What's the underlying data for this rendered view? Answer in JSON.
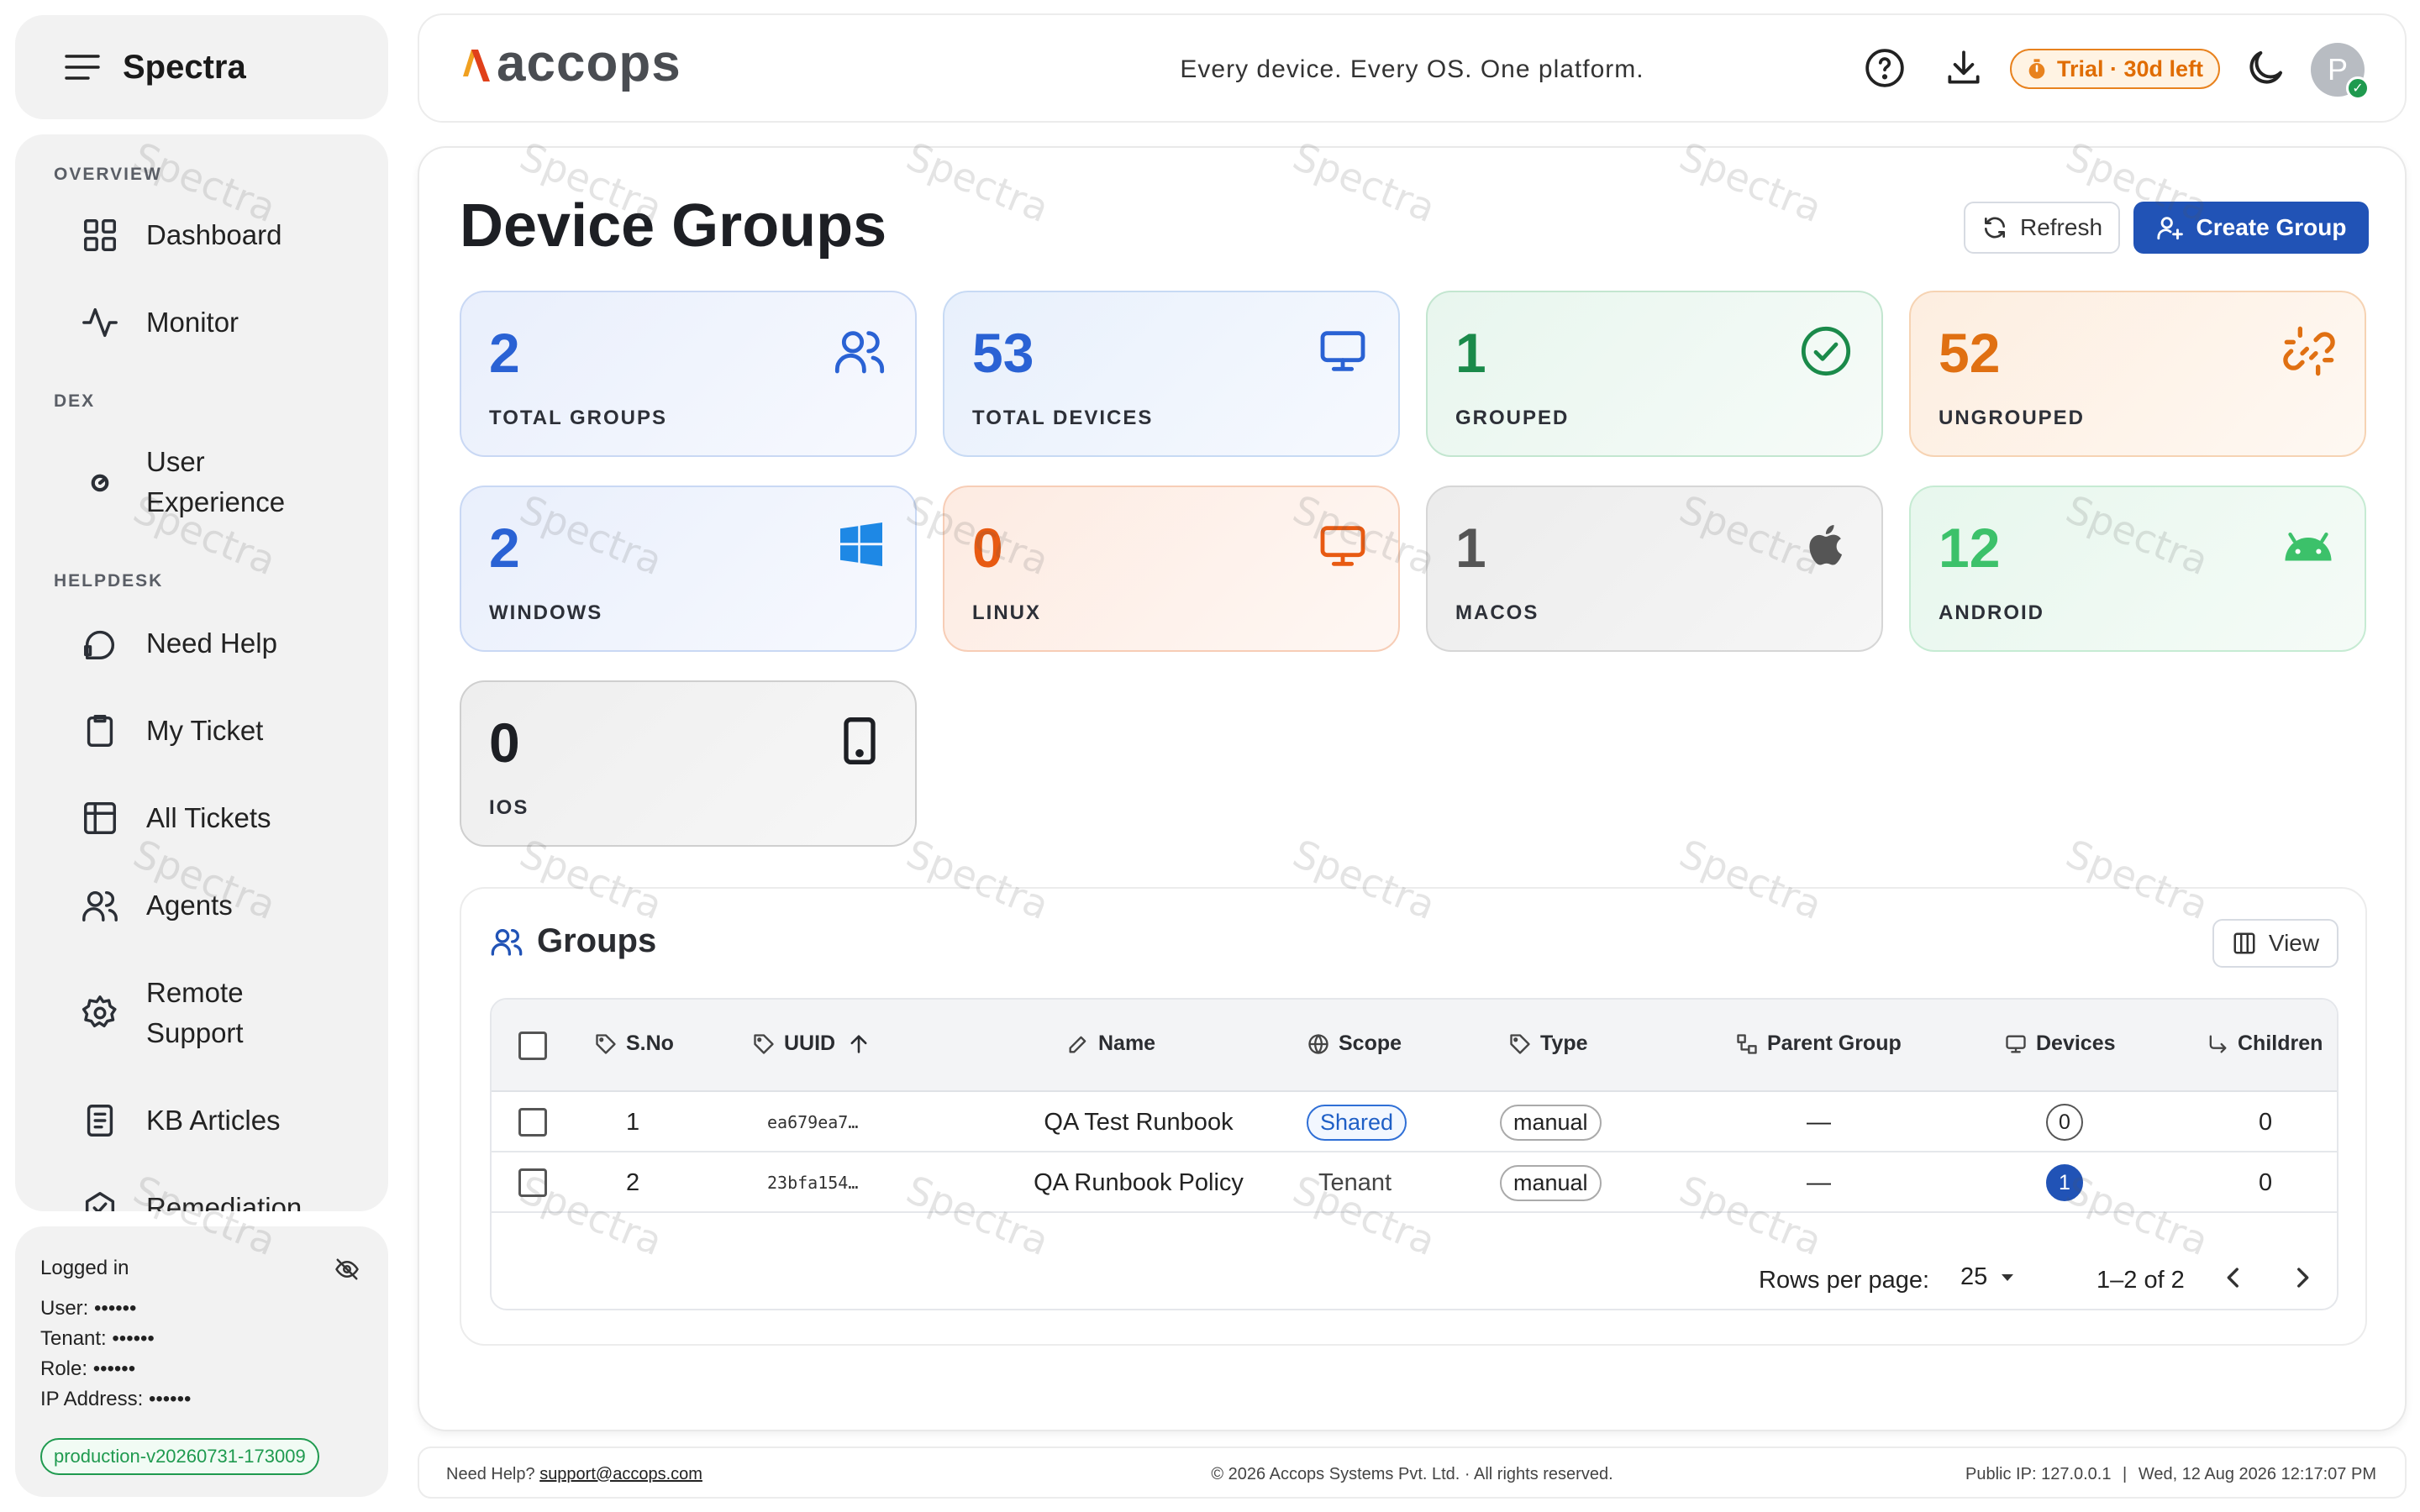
{
  "sidebar": {
    "app_name": "Spectra",
    "sections": {
      "overview": "OVERVIEW",
      "dex": "DEX",
      "helpdesk": "HELPDESK"
    },
    "items": {
      "dashboard": "Dashboard",
      "monitor": "Monitor",
      "user_experience": "User Experience",
      "need_help": "Need Help",
      "my_ticket": "My Ticket",
      "all_tickets": "All Tickets",
      "agents": "Agents",
      "remote_support": "Remote Support",
      "kb_articles": "KB Articles",
      "remediation": "Remediation"
    },
    "footer": {
      "logged_in": "Logged in",
      "user": "User: ••••••",
      "tenant": "Tenant: ••••••",
      "role": "Role: ••••••",
      "ip": "IP Address: ••••••",
      "version": "production-v20260731-173009"
    }
  },
  "topbar": {
    "logo_text": "accops",
    "tagline": "Every device. Every OS. One platform.",
    "trial": "Trial · 30d left",
    "avatar_initial": "P",
    "icons": [
      "help-circle-icon",
      "download-icon",
      "timer-icon",
      "moon-icon"
    ]
  },
  "page": {
    "title": "Device Groups",
    "refresh_label": "Refresh",
    "create_label": "Create Group"
  },
  "stats": [
    {
      "value": "2",
      "label": "TOTAL GROUPS",
      "icon": "users-icon",
      "color": "#2a62d4"
    },
    {
      "value": "53",
      "label": "TOTAL DEVICES",
      "icon": "monitor-icon",
      "color": "#2a62d4"
    },
    {
      "value": "1",
      "label": "GROUPED",
      "icon": "check-circle-icon",
      "color": "#1a8a4a"
    },
    {
      "value": "52",
      "label": "UNGROUPED",
      "icon": "unlink-icon",
      "color": "#e07012"
    },
    {
      "value": "2",
      "label": "WINDOWS",
      "icon": "windows-icon",
      "color": "#2a62d4"
    },
    {
      "value": "0",
      "label": "LINUX",
      "icon": "monitor-icon",
      "color": "#e85a12"
    },
    {
      "value": "1",
      "label": "MACOS",
      "icon": "apple-icon",
      "color": "#555555"
    },
    {
      "value": "12",
      "label": "ANDROID",
      "icon": "android-icon",
      "color": "#3cc16a"
    },
    {
      "value": "0",
      "label": "IOS",
      "icon": "tablet-icon",
      "color": "#1d1f24"
    }
  ],
  "groups": {
    "title": "Groups",
    "view_label": "View",
    "columns": [
      "S.No",
      "UUID",
      "Name",
      "Scope",
      "Type",
      "Parent Group",
      "Devices",
      "Children"
    ],
    "rows": [
      {
        "sno": "1",
        "uuid": "ea679ea7…",
        "name": "QA Test Runbook",
        "scope": "Shared",
        "type": "manual",
        "parent": "—",
        "devices": "0",
        "children": "0"
      },
      {
        "sno": "2",
        "uuid": "23bfa154…",
        "name": "QA Runbook Policy",
        "scope": "Tenant",
        "type": "manual",
        "parent": "—",
        "devices": "1",
        "children": "0"
      }
    ],
    "rows_per_page_label": "Rows per page:",
    "rows_per_page_value": "25",
    "range": "1–2 of 2"
  },
  "footer": {
    "help_prefix": "Need Help?",
    "help_email": "support@accops.com",
    "copyright": "© 2026 Accops Systems Pvt. Ltd. · All rights reserved.",
    "public_ip": "Public IP: 127.0.0.1",
    "datetime": "Wed, 12 Aug 2026 12:17:07 PM"
  },
  "watermark": "Spectra"
}
